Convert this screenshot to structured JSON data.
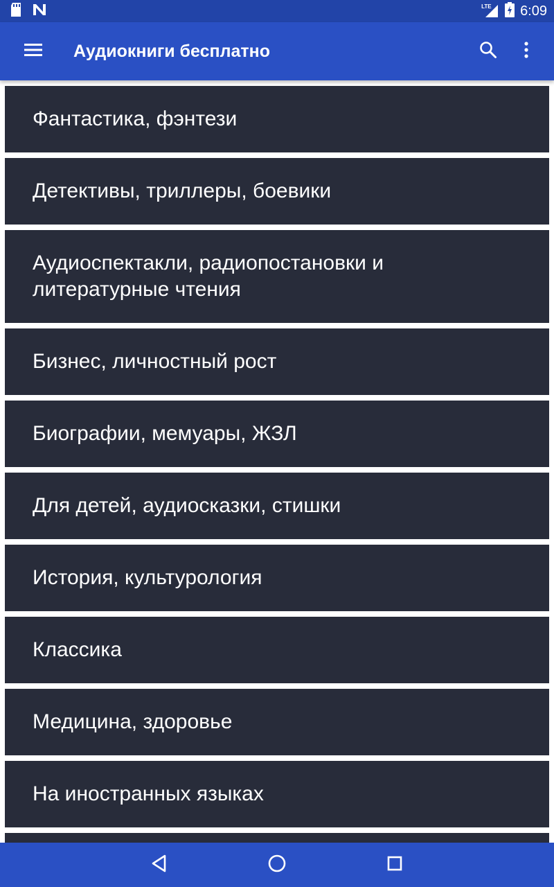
{
  "status_bar": {
    "network_label": "LTE",
    "time": "6:09"
  },
  "app_bar": {
    "title": "Аудиокниги бесплатно",
    "menu_icon": "hamburger-menu-icon",
    "search_icon": "search-icon",
    "more_icon": "more-vertical-icon"
  },
  "categories": [
    "Фантастика, фэнтези",
    "Детективы, триллеры, боевики",
    "Аудиоспектакли, радиопостановки и литературные чтения",
    "Бизнес, личностный рост",
    "Биографии, мемуары, ЖЗЛ",
    "Для детей, аудиосказки, стишки",
    "История, культурология",
    "Классика",
    "Медицина, здоровье",
    "На иностранных языках"
  ],
  "nav_bar": {
    "back_icon": "back-triangle-icon",
    "home_icon": "home-circle-icon",
    "recents_icon": "recents-square-icon"
  },
  "colors": {
    "status_bar": "#2244a8",
    "app_bar": "#2a50c4",
    "list_item": "#282c3a",
    "divider": "#ffffff"
  }
}
